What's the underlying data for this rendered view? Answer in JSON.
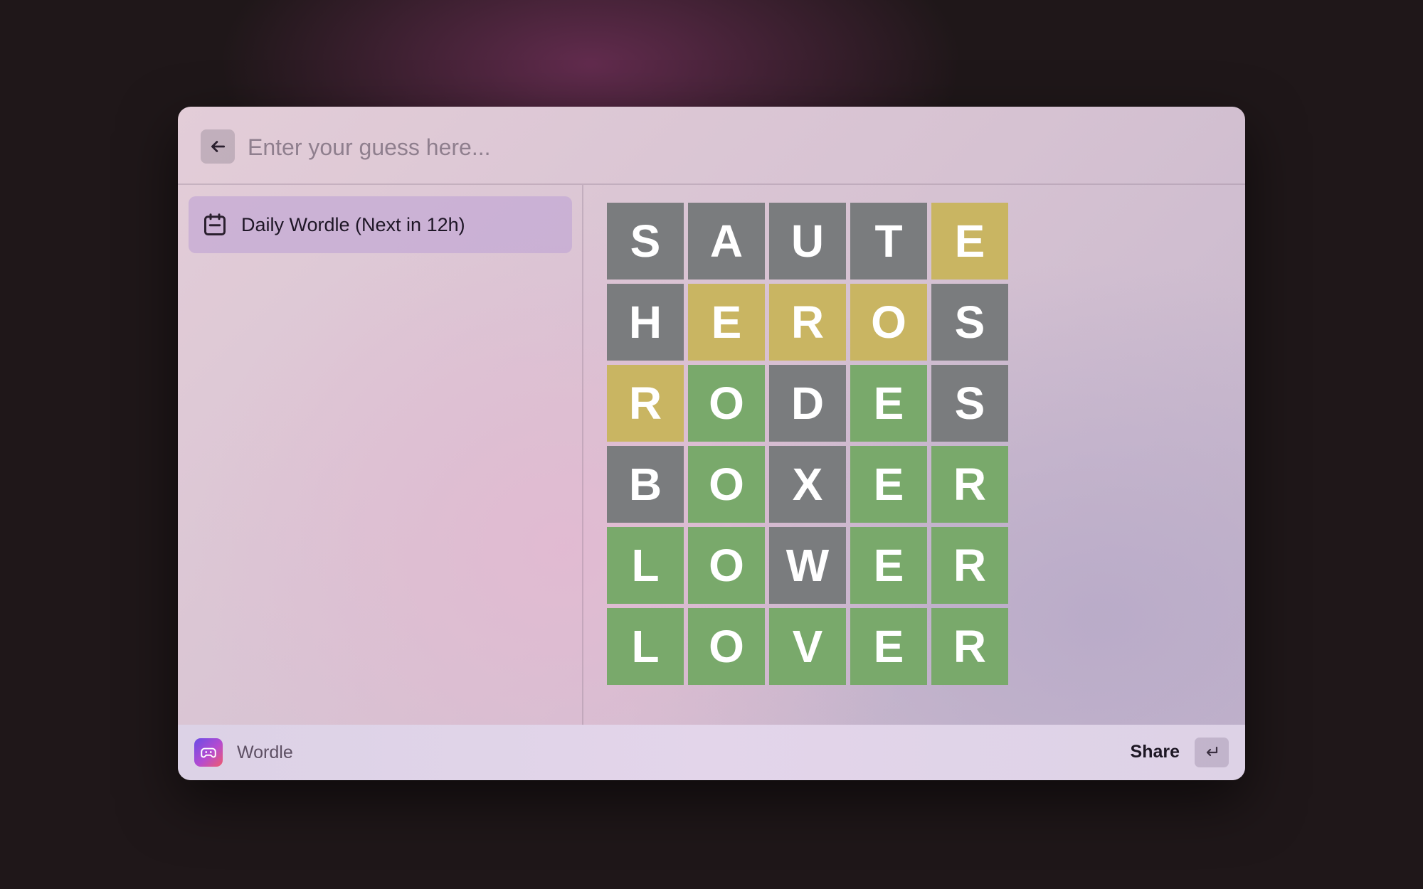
{
  "search": {
    "placeholder": "Enter your guess here...",
    "value": "",
    "back_icon": "arrow-left-icon"
  },
  "sidebar": {
    "items": [
      {
        "label": "Daily Wordle (Next in 12h)",
        "icon": "calendar-icon",
        "selected": true
      }
    ]
  },
  "board": {
    "colors": {
      "absent": "#7a7c7e",
      "present": "#c9b562",
      "correct": "#79a96b"
    },
    "rows": [
      [
        {
          "letter": "S",
          "state": "absent"
        },
        {
          "letter": "A",
          "state": "absent"
        },
        {
          "letter": "U",
          "state": "absent"
        },
        {
          "letter": "T",
          "state": "absent"
        },
        {
          "letter": "E",
          "state": "present"
        }
      ],
      [
        {
          "letter": "H",
          "state": "absent"
        },
        {
          "letter": "E",
          "state": "present"
        },
        {
          "letter": "R",
          "state": "present"
        },
        {
          "letter": "O",
          "state": "present"
        },
        {
          "letter": "S",
          "state": "absent"
        }
      ],
      [
        {
          "letter": "R",
          "state": "present"
        },
        {
          "letter": "O",
          "state": "correct"
        },
        {
          "letter": "D",
          "state": "absent"
        },
        {
          "letter": "E",
          "state": "correct"
        },
        {
          "letter": "S",
          "state": "absent"
        }
      ],
      [
        {
          "letter": "B",
          "state": "absent"
        },
        {
          "letter": "O",
          "state": "correct"
        },
        {
          "letter": "X",
          "state": "absent"
        },
        {
          "letter": "E",
          "state": "correct"
        },
        {
          "letter": "R",
          "state": "correct"
        }
      ],
      [
        {
          "letter": "L",
          "state": "correct"
        },
        {
          "letter": "O",
          "state": "correct"
        },
        {
          "letter": "W",
          "state": "absent"
        },
        {
          "letter": "E",
          "state": "correct"
        },
        {
          "letter": "R",
          "state": "correct"
        }
      ],
      [
        {
          "letter": "L",
          "state": "correct"
        },
        {
          "letter": "O",
          "state": "correct"
        },
        {
          "letter": "V",
          "state": "correct"
        },
        {
          "letter": "E",
          "state": "correct"
        },
        {
          "letter": "R",
          "state": "correct"
        }
      ]
    ]
  },
  "footer": {
    "app_name": "Wordle",
    "app_icon": "game-controller-icon",
    "action_label": "Share",
    "action_key_icon": "return-key-icon"
  }
}
